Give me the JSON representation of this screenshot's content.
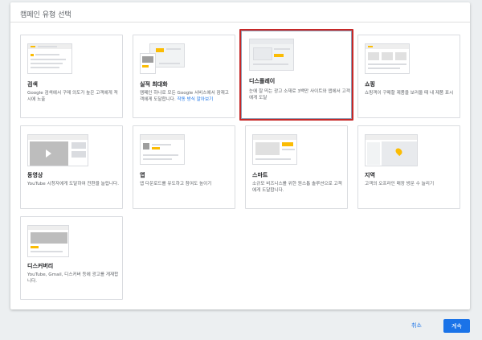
{
  "dialog": {
    "title": "캠페인 유형 선택"
  },
  "cards": [
    {
      "id": "search",
      "title": "검색",
      "desc": "Google 검색에서 구매 의도가 높은 고객에게 적시에 노출",
      "selected": false
    },
    {
      "id": "performance-max",
      "title": "실적 최대화",
      "desc": "캠페인 하나로 모든 Google 서비스에서 잠재고객에게 도달합니다. ",
      "link": "작동 방식 알아보기",
      "selected": false
    },
    {
      "id": "display",
      "title": "디스플레이",
      "desc": "눈에 잘 띄는 광고 소재로 3백만 사이트와 앱에서 고객에게 도달",
      "selected": true
    },
    {
      "id": "shopping",
      "title": "쇼핑",
      "desc": "쇼핑객이 구매할 제품을 보러올 때 내 제품 표시",
      "selected": false
    },
    {
      "id": "video",
      "title": "동영상",
      "desc": "YouTube 시청자에게 도달하여 전환을 늘립니다.",
      "selected": false
    },
    {
      "id": "app",
      "title": "앱",
      "desc": "앱 다운로드를 유도하고 참여도 높이기",
      "selected": false
    },
    {
      "id": "smart",
      "title": "스마트",
      "desc": "소규모 비즈니스를 위한 원스톱 솔루션으로 고객에게 도달합니다.",
      "selected": false
    },
    {
      "id": "local",
      "title": "지역",
      "desc": "고객의 오프라인 매장 방문 수 늘리기",
      "selected": false
    },
    {
      "id": "discovery",
      "title": "디스커버리",
      "desc": "YouTube, Gmail, 디스커버 등에 광고를 게재합니다.",
      "selected": false
    }
  ],
  "footer": {
    "cancel_label": "취소",
    "continue_label": "계속"
  },
  "colors": {
    "accent": "#1a73e8",
    "selected_border": "#c62828",
    "thumb_highlight": "#fbbc04"
  }
}
